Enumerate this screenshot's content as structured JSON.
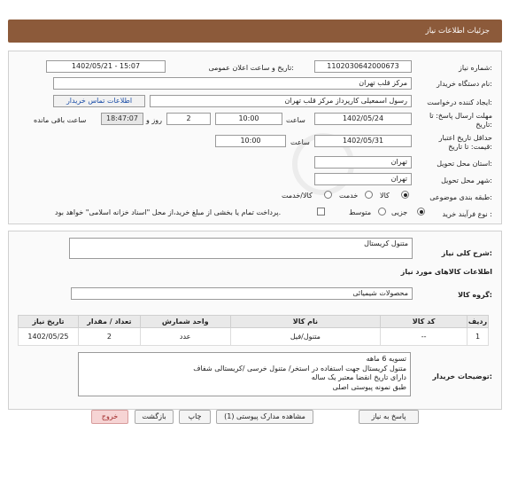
{
  "header": {
    "title": "جزئیات اطلاعات نیاز"
  },
  "need_number": {
    "label": "شماره نیاز:",
    "value": "1102030642000673"
  },
  "announce": {
    "label": "تاریخ و ساعت اعلان عمومی:",
    "value": "1402/05/21 - 15:07"
  },
  "buyer_org": {
    "label": "نام دستگاه خریدار:",
    "value": "مرکز قلب تهران"
  },
  "creator": {
    "label": "ایجاد کننده درخواست:",
    "value": "رسول اسمعیلی کارپرداز مرکز قلب تهران",
    "contact_label": "اطلاعات تماس خریدار"
  },
  "deadline": {
    "label_line1": "مهلت ارسال پاسخ: تا",
    "label_line2": "تاریخ:",
    "date": "1402/05/24",
    "time_label": "ساعت",
    "time": "10:00",
    "days": "2",
    "days_label": "روز و",
    "remaining": "18:47:07",
    "remaining_label": "ساعت باقی مانده"
  },
  "min_validity": {
    "label_line1": "حداقل تاریخ اعتبار",
    "label_line2": "قیمت: تا تاریخ:",
    "date": "1402/05/31",
    "time_label": "ساعت",
    "time": "10:00"
  },
  "delivery_province": {
    "label": "استان محل تحویل:",
    "value": "تهران"
  },
  "delivery_city": {
    "label": "شهر محل تحویل:",
    "value": "تهران"
  },
  "category": {
    "label": "طبقه بندی موضوعی:",
    "options": [
      "کالا",
      "خدمت",
      "کالا/خدمت"
    ],
    "selected": "کالا"
  },
  "process": {
    "label": "نوع فرآیند خرید :",
    "options": [
      "جزیی",
      "متوسط"
    ],
    "selected": "جزیی",
    "payment_note": "پرداخت تمام یا بخشی از مبلغ خرید،از محل \"اسناد خزانه اسلامی\" خواهد بود."
  },
  "summary": {
    "label": "شرح کلی نیاز:",
    "value": "متنول کریستال"
  },
  "goods_info_title": "اطلاعات کالاهای مورد نیاز",
  "goods_group": {
    "label": "گروه کالا:",
    "value": "محصولات شیمیائی"
  },
  "table": {
    "headers": [
      "ردیف",
      "کد کالا",
      "نام کالا",
      "واحد شمارش",
      "تعداد / مقدار",
      "تاریخ نیاز"
    ],
    "rows": [
      [
        "1",
        "--",
        "متنول/فیل",
        "عدد",
        "2",
        "1402/05/25"
      ]
    ]
  },
  "buyer_notes": {
    "label": "توضیحات خریدار:",
    "lines": [
      "تسویه 6 ماهه",
      "متنول کریستال جهت استفاده در استخر/ متنول خرسی /کریستالی شفاف",
      "دارای تاریخ انقضا معتبر یک ساله",
      "طبق نمونه پیوستی اصلی"
    ]
  },
  "buttons": {
    "reply": "پاسخ به نیاز",
    "attachments": "مشاهده مدارک پیوستی (1)",
    "print": "چاپ",
    "back": "بازگشت",
    "exit": "خروج"
  },
  "colors": {
    "header_bg": "#8c5a3a",
    "link": "#1d4fa8",
    "exit_bg": "#f6d4d4"
  }
}
